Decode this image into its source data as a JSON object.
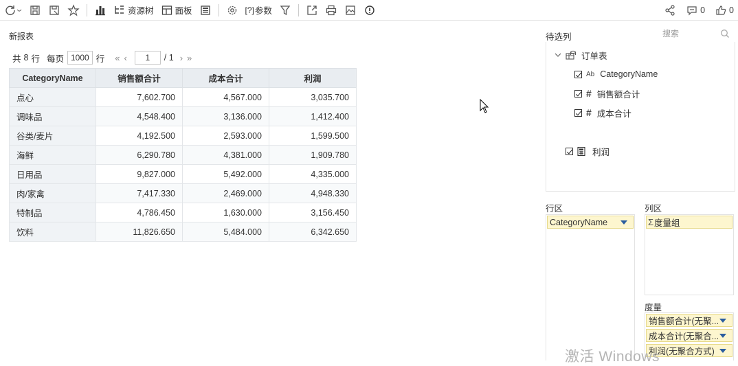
{
  "toolbar": {
    "tree_label": "资源树",
    "panel_label": "面板",
    "params_label": "参数",
    "params_prefix": "[?]",
    "comment_count": "0",
    "like_count": "0"
  },
  "report": {
    "title": "新报表",
    "pager": {
      "total_prefix": "共",
      "total_count": "8",
      "total_suffix": "行",
      "per_page_label": "每页",
      "per_page_value": "1000",
      "per_page_suffix": "行",
      "current_page": "1",
      "total_pages": "/ 1"
    },
    "table": {
      "headers": [
        "CategoryName",
        "销售额合计",
        "成本合计",
        "利润"
      ],
      "rows": [
        [
          "点心",
          "7,602.700",
          "4,567.000",
          "3,035.700"
        ],
        [
          "调味品",
          "4,548.400",
          "3,136.000",
          "1,412.400"
        ],
        [
          "谷类/麦片",
          "4,192.500",
          "2,593.000",
          "1,599.500"
        ],
        [
          "海鲜",
          "6,290.780",
          "4,381.000",
          "1,909.780"
        ],
        [
          "日用品",
          "9,827.000",
          "5,492.000",
          "4,335.000"
        ],
        [
          "肉/家禽",
          "7,417.330",
          "2,469.000",
          "4,948.330"
        ],
        [
          "特制品",
          "4,786.450",
          "1,630.000",
          "3,156.450"
        ],
        [
          "饮料",
          "11,826.650",
          "5,484.000",
          "6,342.650"
        ]
      ]
    }
  },
  "side": {
    "title": "待选列",
    "search_placeholder": "搜索",
    "tree": {
      "root": "订单表",
      "fields": [
        {
          "icon": "text-field-icon",
          "icon_text": "Ab",
          "label": "CategoryName",
          "checked": true
        },
        {
          "icon": "number-field-icon",
          "icon_text": "#",
          "label": "销售额合计",
          "checked": true
        },
        {
          "icon": "number-field-icon",
          "icon_text": "#",
          "label": "成本合计",
          "checked": true
        }
      ],
      "calc_field": {
        "icon": "calculator-icon",
        "label": "利润",
        "checked": true
      }
    },
    "row_zone": {
      "label": "行区",
      "items": [
        "CategoryName"
      ]
    },
    "col_zone": {
      "label": "列区",
      "items": [
        "度量组"
      ]
    },
    "measure_zone": {
      "label": "度量",
      "items": [
        "销售额合计(无聚...",
        "成本合计(无聚合...",
        "利润(无聚合方式)"
      ]
    }
  },
  "watermark": "激活 Windows",
  "colors": {
    "pill_bg": "#fdf6cf",
    "header_bg": "#e9edf1",
    "arrow": "#2a5d9f"
  }
}
